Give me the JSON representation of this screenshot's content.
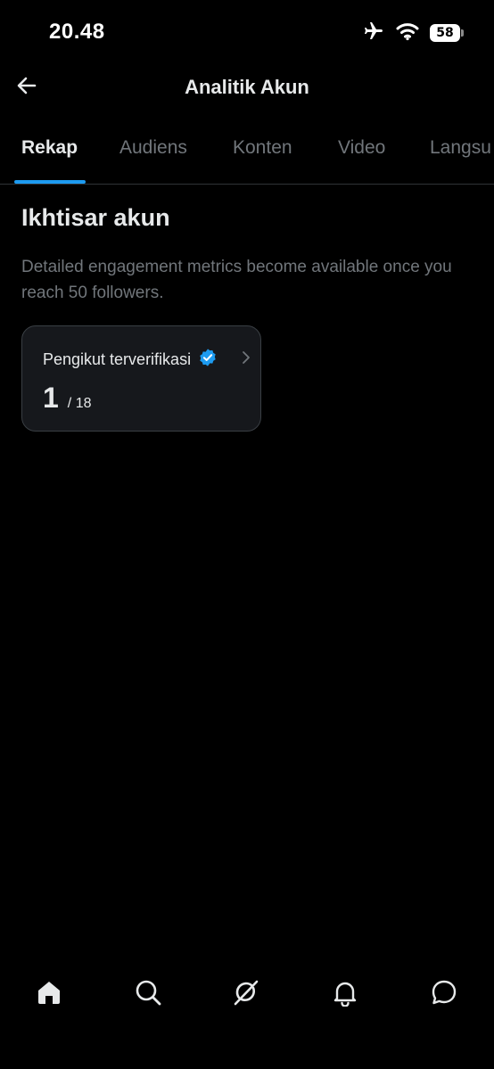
{
  "status_bar": {
    "time": "20.48",
    "battery": "58",
    "icons": [
      "airplane-icon",
      "wifi-icon",
      "battery-icon"
    ]
  },
  "header": {
    "title": "Analitik Akun",
    "back_icon": "arrow-left-icon"
  },
  "tabs": [
    {
      "label": "Rekap",
      "active": true
    },
    {
      "label": "Audiens",
      "active": false
    },
    {
      "label": "Konten",
      "active": false
    },
    {
      "label": "Video",
      "active": false
    },
    {
      "label": "Langsu",
      "active": false
    }
  ],
  "overview": {
    "title": "Ikhtisar akun",
    "info": "Detailed engagement metrics become available once you reach 50 followers."
  },
  "card": {
    "label": "Pengikut terverifikasi",
    "value": "1",
    "total": "/ 18",
    "badge_icon": "verified-badge-icon",
    "chevron_icon": "chevron-right-icon"
  },
  "bottom_nav": [
    {
      "icon": "home-icon"
    },
    {
      "icon": "search-icon"
    },
    {
      "icon": "grok-icon"
    },
    {
      "icon": "bell-icon"
    },
    {
      "icon": "chat-icon"
    }
  ],
  "colors": {
    "background": "#000000",
    "accent": "#1d9bf0",
    "text_primary": "#e7e9ea",
    "text_secondary": "#71767b",
    "card_bg": "#16181c"
  }
}
